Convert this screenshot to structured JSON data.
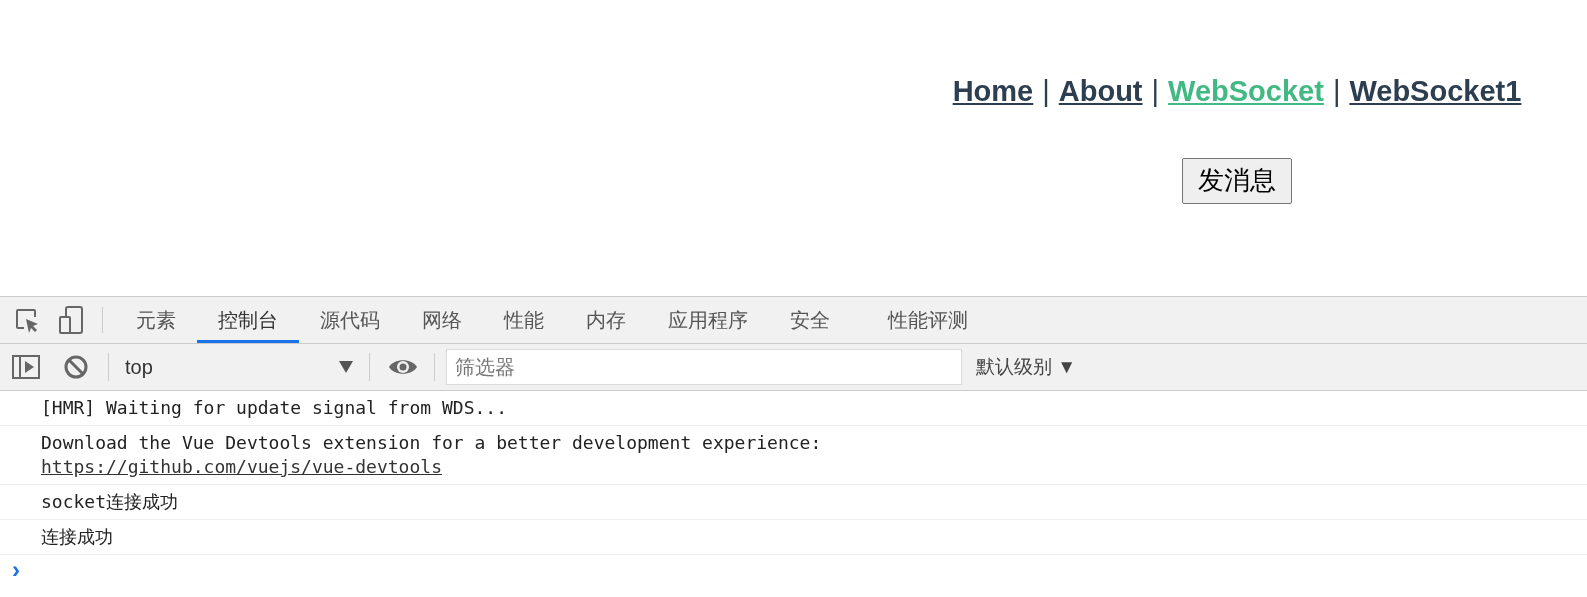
{
  "nav": [
    {
      "kind": "link",
      "label": "Home",
      "selected": false
    },
    {
      "kind": "separator",
      "label": "|"
    },
    {
      "kind": "link",
      "label": "About",
      "selected": false
    },
    {
      "kind": "separator",
      "label": "|"
    },
    {
      "kind": "link",
      "label": "WebSocket",
      "selected": true
    },
    {
      "kind": "separator",
      "label": "|"
    },
    {
      "kind": "link",
      "label": "WebSocket1",
      "selected": false
    }
  ],
  "send_button": "发消息",
  "devtools": {
    "tabs": [
      {
        "label": "元素",
        "selected": false
      },
      {
        "label": "控制台",
        "selected": true
      },
      {
        "label": "源代码",
        "selected": false
      },
      {
        "label": "网络",
        "selected": false
      },
      {
        "label": "性能",
        "selected": false
      },
      {
        "label": "内存",
        "selected": false
      },
      {
        "label": "应用程序",
        "selected": false
      },
      {
        "label": "安全",
        "selected": false
      },
      {
        "label": "性能评测",
        "selected": false
      }
    ],
    "context": "top",
    "filter": {
      "placeholder": "筛选器"
    },
    "levels": "默认级别 ▼",
    "messages": [
      {
        "text": "[HMR] Waiting for update signal from WDS..."
      },
      {
        "text": "Download the Vue Devtools extension for a better development experience:",
        "link": "https://github.com/vuejs/vue-devtools"
      },
      {
        "text": "socket连接成功"
      },
      {
        "text": "连接成功"
      }
    ],
    "prompt": "›"
  }
}
